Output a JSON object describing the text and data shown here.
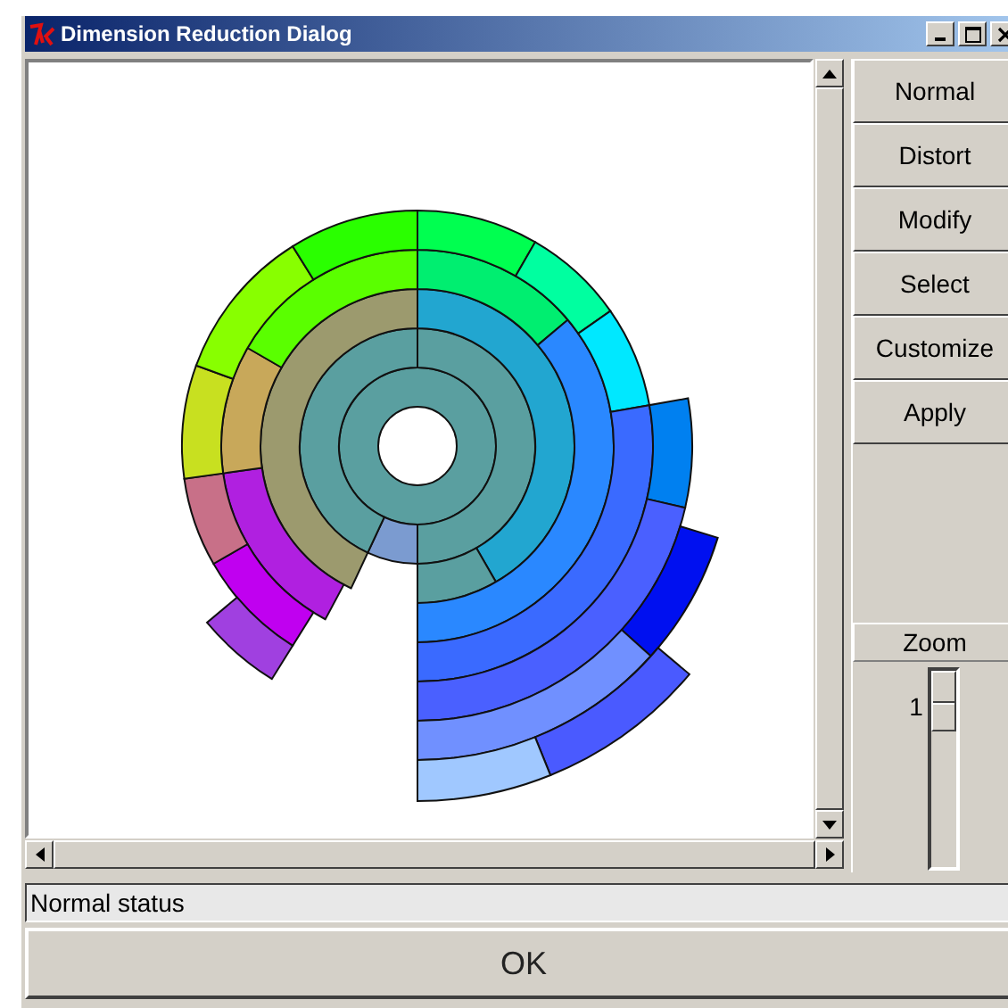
{
  "window": {
    "title": "Dimension Reduction Dialog"
  },
  "side_buttons": [
    "Normal",
    "Distort",
    "Modify",
    "Select",
    "Customize",
    "Apply"
  ],
  "zoom": {
    "label": "Zoom",
    "value": "1",
    "level": 0
  },
  "status_bar": "Normal status",
  "ok_button": "OK"
}
